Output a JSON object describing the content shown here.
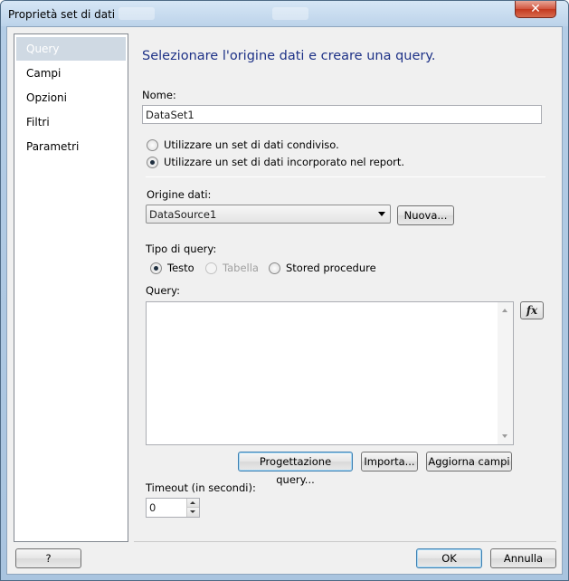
{
  "window": {
    "title": "Proprietà set di dati",
    "close_glyph": "✕"
  },
  "nav": {
    "items": [
      {
        "label": "Query",
        "selected": true
      },
      {
        "label": "Campi",
        "selected": false
      },
      {
        "label": "Opzioni",
        "selected": false
      },
      {
        "label": "Filtri",
        "selected": false
      },
      {
        "label": "Parametri",
        "selected": false
      }
    ]
  },
  "main": {
    "heading": "Selezionare l'origine dati e creare una query.",
    "name_label": "Nome:",
    "name_value": "DataSet1",
    "radio_shared": "Utilizzare un set di dati condiviso.",
    "radio_embedded": "Utilizzare un set di dati incorporato nel report.",
    "datasource_label": "Origine dati:",
    "datasource_value": "DataSource1",
    "new_button": "Nuova...",
    "query_type_label": "Tipo di query:",
    "query_type_options": [
      "Testo",
      "Tabella",
      "Stored procedure"
    ],
    "query_label": "Query:",
    "query_text": "",
    "fx_label": "fx",
    "design_button": "Progettazione query...",
    "import_button": "Importa...",
    "refresh_button": "Aggiorna campi",
    "timeout_label": "Timeout (in secondi):",
    "timeout_value": "0"
  },
  "footer": {
    "help_button": "?",
    "ok_button": "OK",
    "cancel_button": "Annulla"
  },
  "colors": {
    "heading": "#1e3287",
    "selected_nav": "#cfd9e3",
    "frame": "#b4cde6"
  }
}
